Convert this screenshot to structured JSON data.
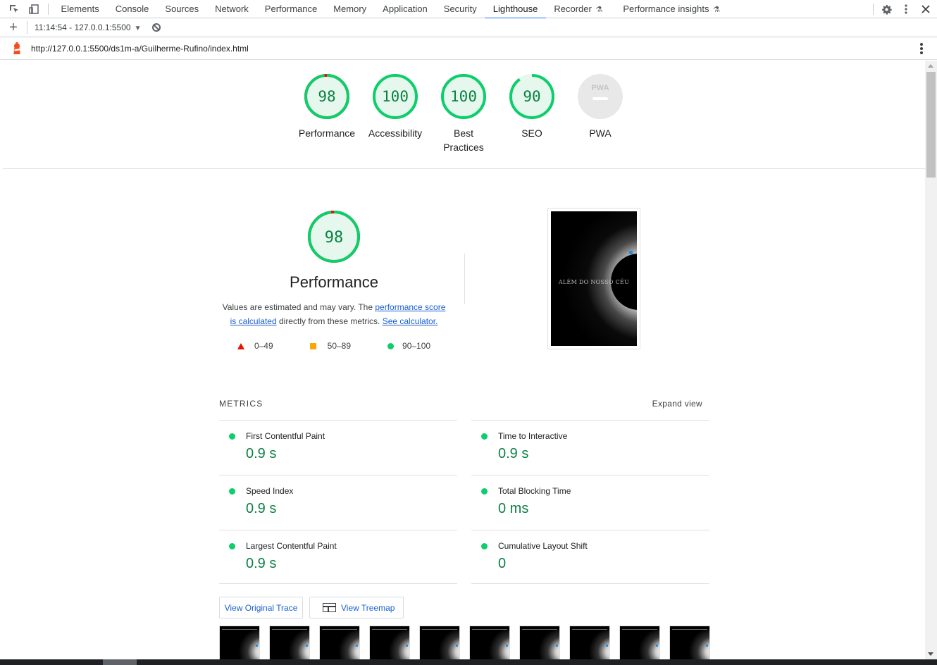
{
  "devtools": {
    "tabs": [
      {
        "label": "Elements"
      },
      {
        "label": "Console"
      },
      {
        "label": "Sources"
      },
      {
        "label": "Network"
      },
      {
        "label": "Performance"
      },
      {
        "label": "Memory"
      },
      {
        "label": "Application"
      },
      {
        "label": "Security"
      },
      {
        "label": "Lighthouse",
        "active": true
      },
      {
        "label": "Recorder",
        "experimental": true
      },
      {
        "label": "Performance insights",
        "experimental": true
      }
    ],
    "active_tab": "Lighthouse"
  },
  "lighthouse_toolbar": {
    "new_report_icon": "plus-icon",
    "report_select": "11:14:54 - 127.0.0.1:5500",
    "clear_icon": "block-icon"
  },
  "report": {
    "url": "http://127.0.0.1:5500/ds1m-a/Guilherme-Rufino/index.html",
    "scores": [
      {
        "value": "98",
        "label": "Performance",
        "score": 0.98
      },
      {
        "value": "100",
        "label": "Accessibility",
        "score": 1.0
      },
      {
        "value": "100",
        "label": "Best Practices",
        "label_line1": "Best",
        "label_line2": "Practices",
        "score": 1.0
      },
      {
        "value": "90",
        "label": "SEO",
        "score": 0.9
      },
      {
        "value": "PWA",
        "label": "PWA",
        "score": null
      }
    ],
    "performance": {
      "score": "98",
      "score_fraction": 0.98,
      "title": "Performance",
      "desc_prefix": "Values are estimated and may vary. The ",
      "desc_link1a": "performance score",
      "desc_link1b": "is calculated",
      "desc_middle": " directly from these metrics. ",
      "desc_link2": "See calculator.",
      "legend": [
        {
          "range": "0–49",
          "shape": "triangle",
          "color": "#eb0f00"
        },
        {
          "range": "50–89",
          "shape": "square",
          "color": "#ffa400"
        },
        {
          "range": "90–100",
          "shape": "circle",
          "color": "#0cce6b"
        }
      ]
    },
    "screenshot": {
      "headline": "ALÉM DO NOSSO CÉU"
    },
    "metrics": {
      "heading": "METRICS",
      "expand": "Expand view",
      "items": [
        {
          "name": "First Contentful Paint",
          "value": "0.9 s"
        },
        {
          "name": "Time to Interactive",
          "value": "0.9 s"
        },
        {
          "name": "Speed Index",
          "value": "0.9 s"
        },
        {
          "name": "Total Blocking Time",
          "value": "0 ms"
        },
        {
          "name": "Largest Contentful Paint",
          "value": "0.9 s"
        },
        {
          "name": "Cumulative Layout Shift",
          "value": "0"
        }
      ]
    },
    "buttons": {
      "view_trace": "View Original Trace",
      "view_treemap": "View Treemap"
    }
  },
  "colors": {
    "pass": "#0cce6b",
    "pass_text": "#0b8043",
    "fail": "#eb0f00",
    "average": "#ffa400",
    "accent": "#1a73e8"
  }
}
